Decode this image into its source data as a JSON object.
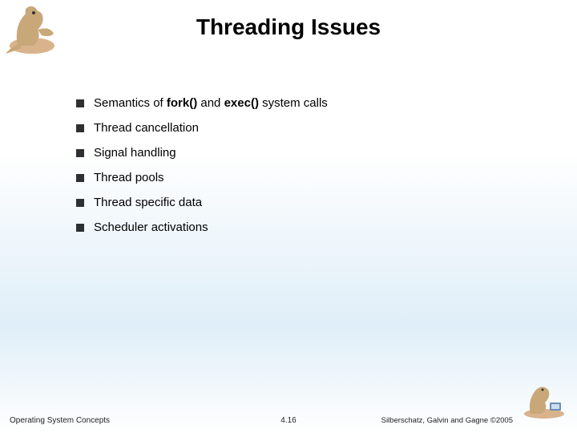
{
  "title": "Threading Issues",
  "bullets": [
    {
      "html": "Semantics of <b>fork()</b> and <b>exec()</b> system calls"
    },
    {
      "html": "Thread cancellation"
    },
    {
      "html": "Signal handling"
    },
    {
      "html": "Thread pools"
    },
    {
      "html": "Thread specific data"
    },
    {
      "html": "Scheduler activations"
    }
  ],
  "footer": {
    "left": "Operating System Concepts",
    "center": "4.16",
    "right": "Silberschatz, Galvin and Gagne ©2005"
  }
}
